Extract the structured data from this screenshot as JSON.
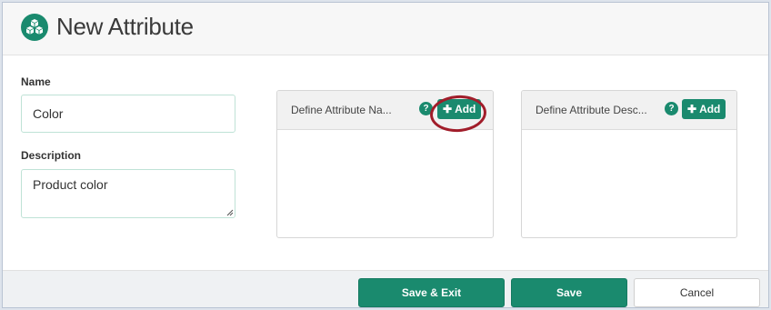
{
  "header": {
    "title": "New Attribute",
    "icon": "cubes-icon"
  },
  "form": {
    "name_label": "Name",
    "name_value": "Color",
    "description_label": "Description",
    "description_value": "Product color"
  },
  "panels": [
    {
      "title": "Define Attribute Na...",
      "help": "?",
      "add_label": "Add"
    },
    {
      "title": "Define Attribute Desc...",
      "help": "?",
      "add_label": "Add"
    }
  ],
  "footer": {
    "save_exit_label": "Save & Exit",
    "save_label": "Save",
    "cancel_label": "Cancel"
  },
  "colors": {
    "accent": "#1a8a6e",
    "highlight": "#a11d2a"
  }
}
